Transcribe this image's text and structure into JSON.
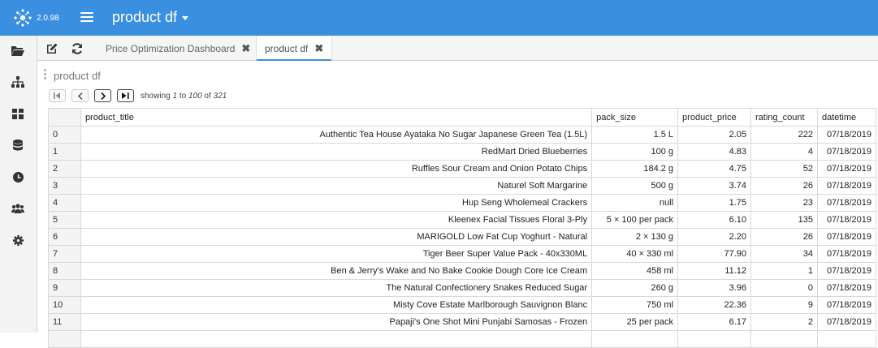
{
  "app": {
    "version": "2.0.98",
    "title": "product df"
  },
  "sidebar": {
    "items": [
      "folder-icon",
      "sitemap-icon",
      "dashboard-icon",
      "database-icon",
      "clock-icon",
      "users-icon",
      "settings-icon"
    ]
  },
  "tabs": [
    {
      "label": "Price Optimization Dashboard",
      "close": "✖"
    },
    {
      "label": "product df",
      "close": "✖"
    }
  ],
  "panel": {
    "title": "product df",
    "showing_prefix": "showing",
    "range_start": "1",
    "range_to": "to",
    "range_end": "100",
    "range_of": "of",
    "total": "321"
  },
  "table": {
    "columns": [
      "",
      "product_title",
      "pack_size",
      "product_price",
      "rating_count",
      "datetime"
    ],
    "rows": [
      [
        "0",
        "Authentic Tea House Ayataka No Sugar Japanese Green Tea (1.5L)",
        "1.5 L",
        "2.05",
        "222",
        "07/18/2019"
      ],
      [
        "1",
        "RedMart Dried Blueberries",
        "100 g",
        "4.83",
        "4",
        "07/18/2019"
      ],
      [
        "2",
        "Ruffles Sour Cream and Onion Potato Chips",
        "184.2 g",
        "4.75",
        "52",
        "07/18/2019"
      ],
      [
        "3",
        "Naturel Soft Margarine",
        "500 g",
        "3.74",
        "26",
        "07/18/2019"
      ],
      [
        "4",
        "Hup Seng Wholemeal Crackers",
        "null",
        "1.75",
        "23",
        "07/18/2019"
      ],
      [
        "5",
        "Kleenex Facial Tissues Floral 3-Ply",
        "5 × 100 per pack",
        "6.10",
        "135",
        "07/18/2019"
      ],
      [
        "6",
        "MARIGOLD Low Fat Cup Yoghurt - Natural",
        "2 × 130 g",
        "2.20",
        "26",
        "07/18/2019"
      ],
      [
        "7",
        "Tiger Beer Super Value Pack - 40x330ML",
        "40 × 330 ml",
        "77.90",
        "34",
        "07/18/2019"
      ],
      [
        "8",
        "Ben & Jerry's Wake and No Bake Cookie Dough Core Ice Cream",
        "458 ml",
        "11.12",
        "1",
        "07/18/2019"
      ],
      [
        "9",
        "The Natural Confectionery Snakes Reduced Sugar",
        "260 g",
        "3.96",
        "0",
        "07/18/2019"
      ],
      [
        "10",
        "Misty Cove Estate Marlborough Sauvignon Blanc",
        "750 ml",
        "22.36",
        "9",
        "07/18/2019"
      ],
      [
        "11",
        "Papaji's One Shot Mini Punjabi Samosas - Frozen",
        "25 per pack",
        "6.17",
        "2",
        "07/18/2019"
      ],
      [
        "",
        "",
        "",
        "",
        "",
        ""
      ]
    ]
  },
  "colors": {
    "topbar": "#3b8fe0",
    "accent": "#3b8fe0"
  }
}
